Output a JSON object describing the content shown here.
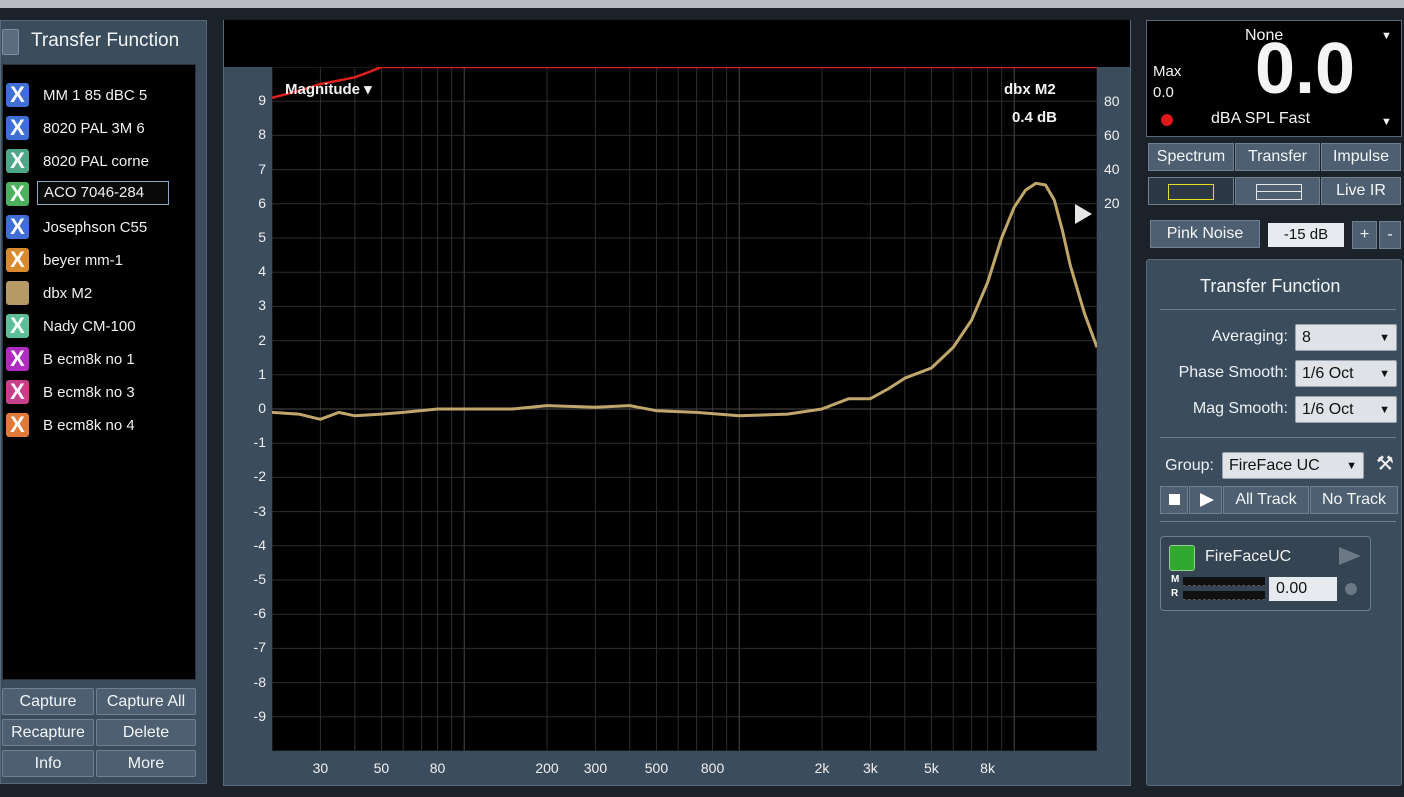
{
  "left_panel": {
    "title": "Transfer Function",
    "traces": [
      {
        "label": "MM 1 85 dBC 5",
        "color": "#3f6fd6",
        "icon": "X"
      },
      {
        "label": "8020 PAL 3M 6",
        "color": "#3f6fd6",
        "icon": "X"
      },
      {
        "label": "8020 PAL corne",
        "color": "#4fa68a",
        "icon": "X"
      },
      {
        "label": "ACO 7046-284",
        "color": "#4db05c",
        "icon": "X"
      },
      {
        "label": "Josephson C55",
        "color": "#3f6fd6",
        "icon": "X"
      },
      {
        "label": "beyer mm-1",
        "color": "#d98a2e",
        "icon": "X"
      },
      {
        "label": "dbx M2",
        "color": "#b59a63",
        "icon": ""
      },
      {
        "label": "Nady CM-100",
        "color": "#5cbf9a",
        "icon": "X"
      },
      {
        "label": "B ecm8k no 1",
        "color": "#b02cc0",
        "icon": "X"
      },
      {
        "label": "B ecm8k no 3",
        "color": "#c63f8a",
        "icon": "X"
      },
      {
        "label": "B ecm8k no 4",
        "color": "#e07a3a",
        "icon": "X"
      }
    ],
    "selected_index": 3,
    "buttons": {
      "capture": "Capture",
      "capture_all": "Capture All",
      "recapture": "Recapture",
      "delete": "Delete",
      "info": "Info",
      "more": "More"
    }
  },
  "plot": {
    "view_label": "Magnitude ▾",
    "trace_name": "dbx M2",
    "trace_value": "0.4 dB",
    "y_labels": [
      "9",
      "8",
      "7",
      "6",
      "5",
      "4",
      "3",
      "2",
      "1",
      "0",
      "-1",
      "-2",
      "-3",
      "-4",
      "-5",
      "-6",
      "-7",
      "-8",
      "-9"
    ],
    "y2_labels": [
      "80",
      "60",
      "40",
      "20"
    ],
    "x_labels": [
      "30",
      "50",
      "80",
      "200",
      "300",
      "500",
      "800",
      "2k",
      "3k",
      "5k",
      "8k"
    ],
    "chart_data": {
      "type": "line",
      "xlabel": "",
      "ylabel": "",
      "xscale": "log",
      "xlim": [
        20,
        20000
      ],
      "ylim": [
        -10,
        10
      ],
      "series": [
        {
          "color": "#c0a66a",
          "x": [
            20,
            25,
            30,
            35,
            40,
            50,
            60,
            80,
            100,
            150,
            200,
            300,
            400,
            500,
            700,
            1000,
            1500,
            2000,
            2500,
            3000,
            3500,
            4000,
            5000,
            6000,
            7000,
            8000,
            9000,
            10000,
            11000,
            12000,
            13000,
            14000,
            15000,
            16000,
            18000,
            20000
          ],
          "y": [
            -0.1,
            -0.15,
            -0.3,
            -0.1,
            -0.2,
            -0.15,
            -0.1,
            0.0,
            0.0,
            0.0,
            0.1,
            0.05,
            0.1,
            -0.05,
            -0.1,
            -0.2,
            -0.15,
            0.0,
            0.3,
            0.3,
            0.6,
            0.9,
            1.2,
            1.8,
            2.6,
            3.7,
            5.0,
            5.9,
            6.4,
            6.6,
            6.55,
            6.1,
            5.2,
            4.2,
            2.8,
            1.8
          ]
        },
        {
          "color": "#e0201c",
          "x": [
            20,
            25,
            30,
            40,
            45,
            50,
            60,
            100,
            1000,
            10000,
            20000
          ],
          "y": [
            9.1,
            9.3,
            9.5,
            9.7,
            9.85,
            10,
            10,
            10,
            10,
            10,
            10
          ]
        }
      ]
    }
  },
  "meter": {
    "source": "None",
    "max_label": "Max",
    "max_value": "0.0",
    "value": "0.0",
    "mode": "dBA SPL Fast"
  },
  "tabs": {
    "spectrum": "Spectrum",
    "transfer": "Transfer",
    "impulse": "Impulse"
  },
  "views": {
    "live_ir": "Live IR"
  },
  "generator": {
    "label": "Pink Noise",
    "level": "-15 dB",
    "plus": "+",
    "minus": "-"
  },
  "tf": {
    "title": "Transfer Function",
    "averaging_label": "Averaging:",
    "averaging_value": "8",
    "phase_label": "Phase Smooth:",
    "phase_value": "1/6 Oct",
    "mag_label": "Mag Smooth:",
    "mag_value": "1/6 Oct",
    "group_label": "Group:",
    "group_value": "FireFace UC",
    "all_track": "All Track",
    "no_track": "No Track",
    "device_name": "FireFaceUC",
    "m_label": "M",
    "r_label": "R",
    "device_value": "0.00"
  }
}
